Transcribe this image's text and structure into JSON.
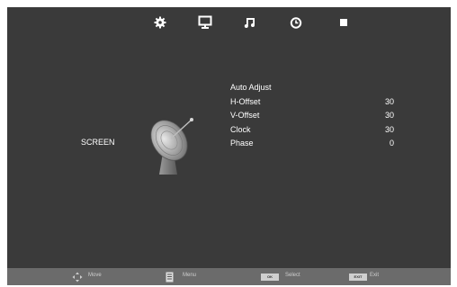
{
  "tabs": [
    {
      "name": "picture-tab",
      "icon": "gear-icon"
    },
    {
      "name": "screen-tab",
      "icon": "monitor-icon",
      "active": true
    },
    {
      "name": "sound-tab",
      "icon": "music-note-icon"
    },
    {
      "name": "time-tab",
      "icon": "clock-icon"
    },
    {
      "name": "option-tab",
      "icon": "square-icon"
    }
  ],
  "screen": {
    "title": "SCREEN"
  },
  "menu": {
    "items": [
      {
        "label": "Auto Adjust",
        "value": ""
      },
      {
        "label": "H-Offset",
        "value": "30"
      },
      {
        "label": "V-Offset",
        "value": "30"
      },
      {
        "label": "Clock",
        "value": "30"
      },
      {
        "label": "Phase",
        "value": "0"
      }
    ]
  },
  "footer": {
    "move": "Move",
    "menu": "Menu",
    "ok_key": "OK",
    "select": "Select",
    "exit_key": "EXIT",
    "exit": "Exit"
  },
  "colors": {
    "background": "#3a3a3a",
    "footer": "#6b6b6b",
    "text": "#ffffff"
  }
}
